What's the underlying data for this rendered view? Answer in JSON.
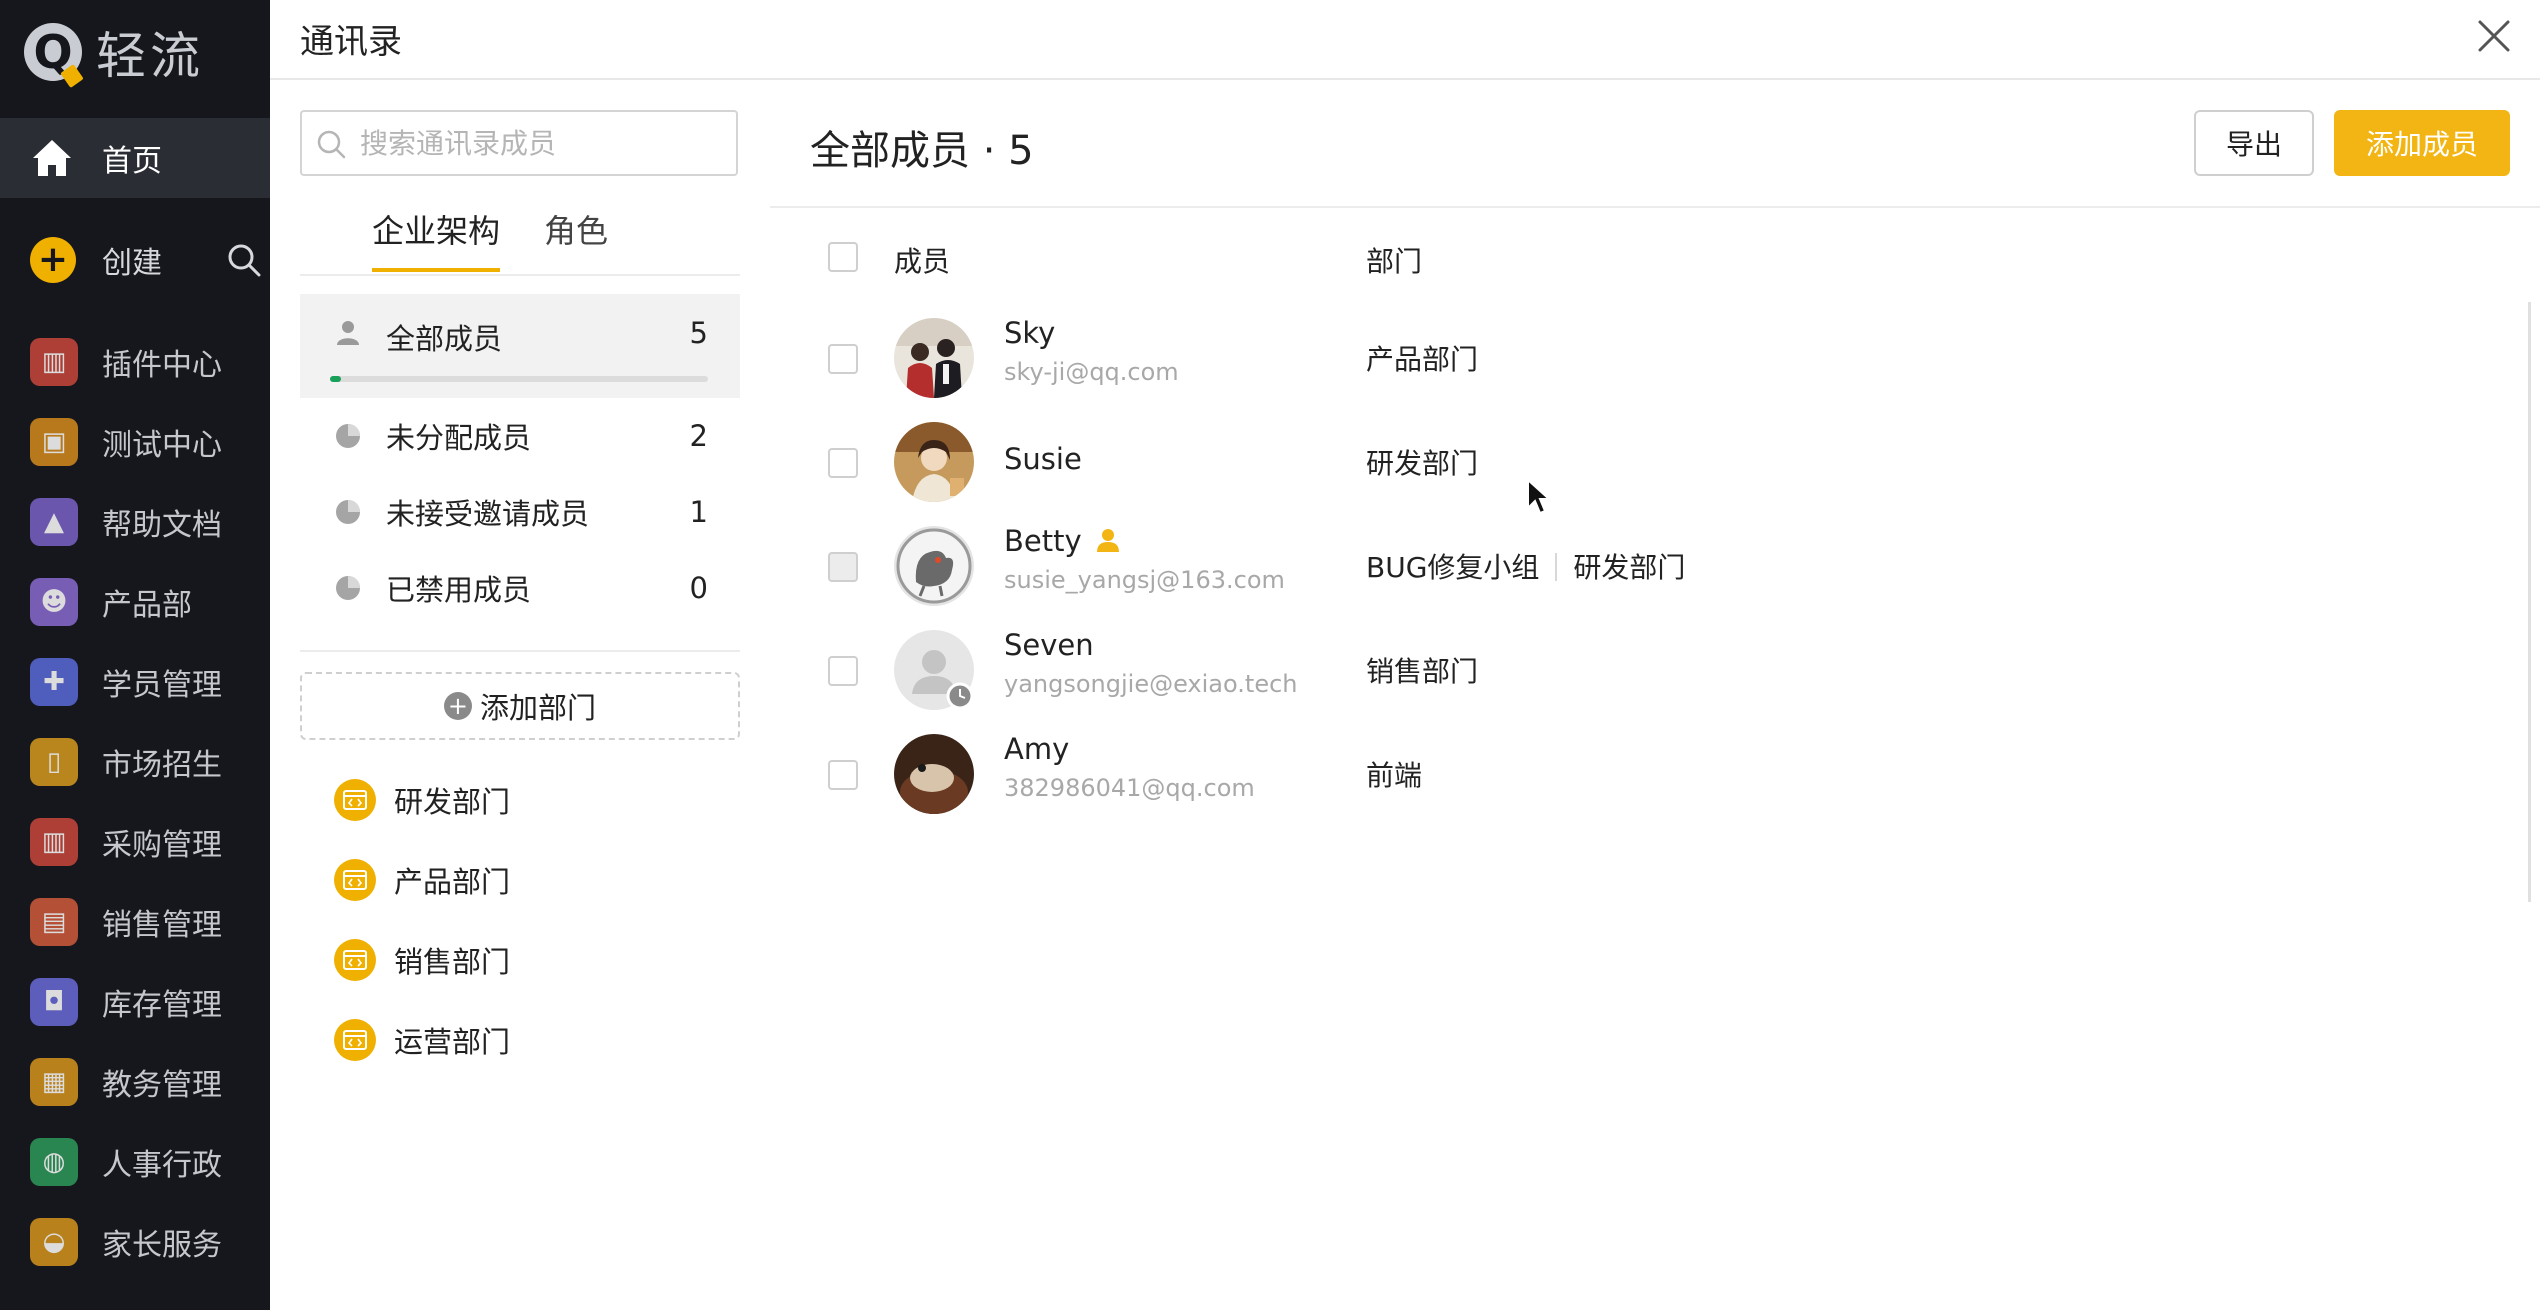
{
  "app": {
    "logo_text": "轻流",
    "home_label": "首页",
    "create_label": "创建",
    "nav_items": [
      {
        "label": "插件中心",
        "icon": "building-icon",
        "color": "#c8473b"
      },
      {
        "label": "测试中心",
        "icon": "id-card-icon",
        "color": "#d58a1c"
      },
      {
        "label": "帮助文档",
        "icon": "cone-icon",
        "color": "#7a61c8"
      },
      {
        "label": "产品部",
        "icon": "robot-icon",
        "color": "#8a6ad0"
      },
      {
        "label": "学员管理",
        "icon": "tools-icon",
        "color": "#5a6ad8"
      },
      {
        "label": "市场招生",
        "icon": "phone-icon",
        "color": "#d59a1c"
      },
      {
        "label": "采购管理",
        "icon": "building-icon",
        "color": "#c8473b"
      },
      {
        "label": "销售管理",
        "icon": "chart-icon",
        "color": "#d05a3b"
      },
      {
        "label": "库存管理",
        "icon": "box-icon",
        "color": "#6a6ad8"
      },
      {
        "label": "教务管理",
        "icon": "book-icon",
        "color": "#d5941c"
      },
      {
        "label": "人事行政",
        "icon": "globe-icon",
        "color": "#2e9a5a"
      },
      {
        "label": "家长服务",
        "icon": "bag-icon",
        "color": "#d5941c"
      }
    ]
  },
  "dialog": {
    "title": "通讯录"
  },
  "sidebar": {
    "search_placeholder": "搜索通讯录成员",
    "tabs": [
      {
        "label": "企业架构",
        "active": true
      },
      {
        "label": "角色",
        "active": false
      }
    ],
    "filters": [
      {
        "label": "全部成员",
        "count": "5",
        "selected": true
      },
      {
        "label": "未分配成员",
        "count": "2"
      },
      {
        "label": "未接受邀请成员",
        "count": "1"
      },
      {
        "label": "已禁用成员",
        "count": "0"
      }
    ],
    "all_members_progress": 0.03,
    "add_department_label": "添加部门",
    "departments": [
      {
        "label": "研发部门"
      },
      {
        "label": "产品部门"
      },
      {
        "label": "销售部门"
      },
      {
        "label": "运营部门"
      }
    ]
  },
  "main": {
    "title": "全部成员 · 5",
    "export_label": "导出",
    "add_member_label": "添加成员",
    "columns": {
      "member": "成员",
      "department": "部门"
    },
    "members": [
      {
        "name": "Sky",
        "email": "sky-ji@qq.com",
        "departments": [
          "产品部门"
        ],
        "admin": false,
        "pending": false,
        "avatar": "photo"
      },
      {
        "name": "Susie",
        "email": "",
        "departments": [
          "研发部门"
        ],
        "admin": false,
        "pending": false,
        "avatar": "photo"
      },
      {
        "name": "Betty",
        "email": "susie_yangsj@163.com",
        "departments": [
          "BUG修复小组",
          "研发部门"
        ],
        "admin": true,
        "pending": false,
        "avatar": "photo",
        "checkbox_disabled": true
      },
      {
        "name": "Seven",
        "email": "yangsongjie@exiao.tech",
        "departments": [
          "销售部门"
        ],
        "admin": false,
        "pending": true,
        "avatar": "placeholder"
      },
      {
        "name": "Amy",
        "email": "382986041@qq.com",
        "departments": [
          "前端"
        ],
        "admin": false,
        "pending": false,
        "avatar": "photo"
      }
    ]
  },
  "colors": {
    "accent": "#f2b514",
    "nav_bg": "#15171c",
    "progress": "#19a15b"
  }
}
